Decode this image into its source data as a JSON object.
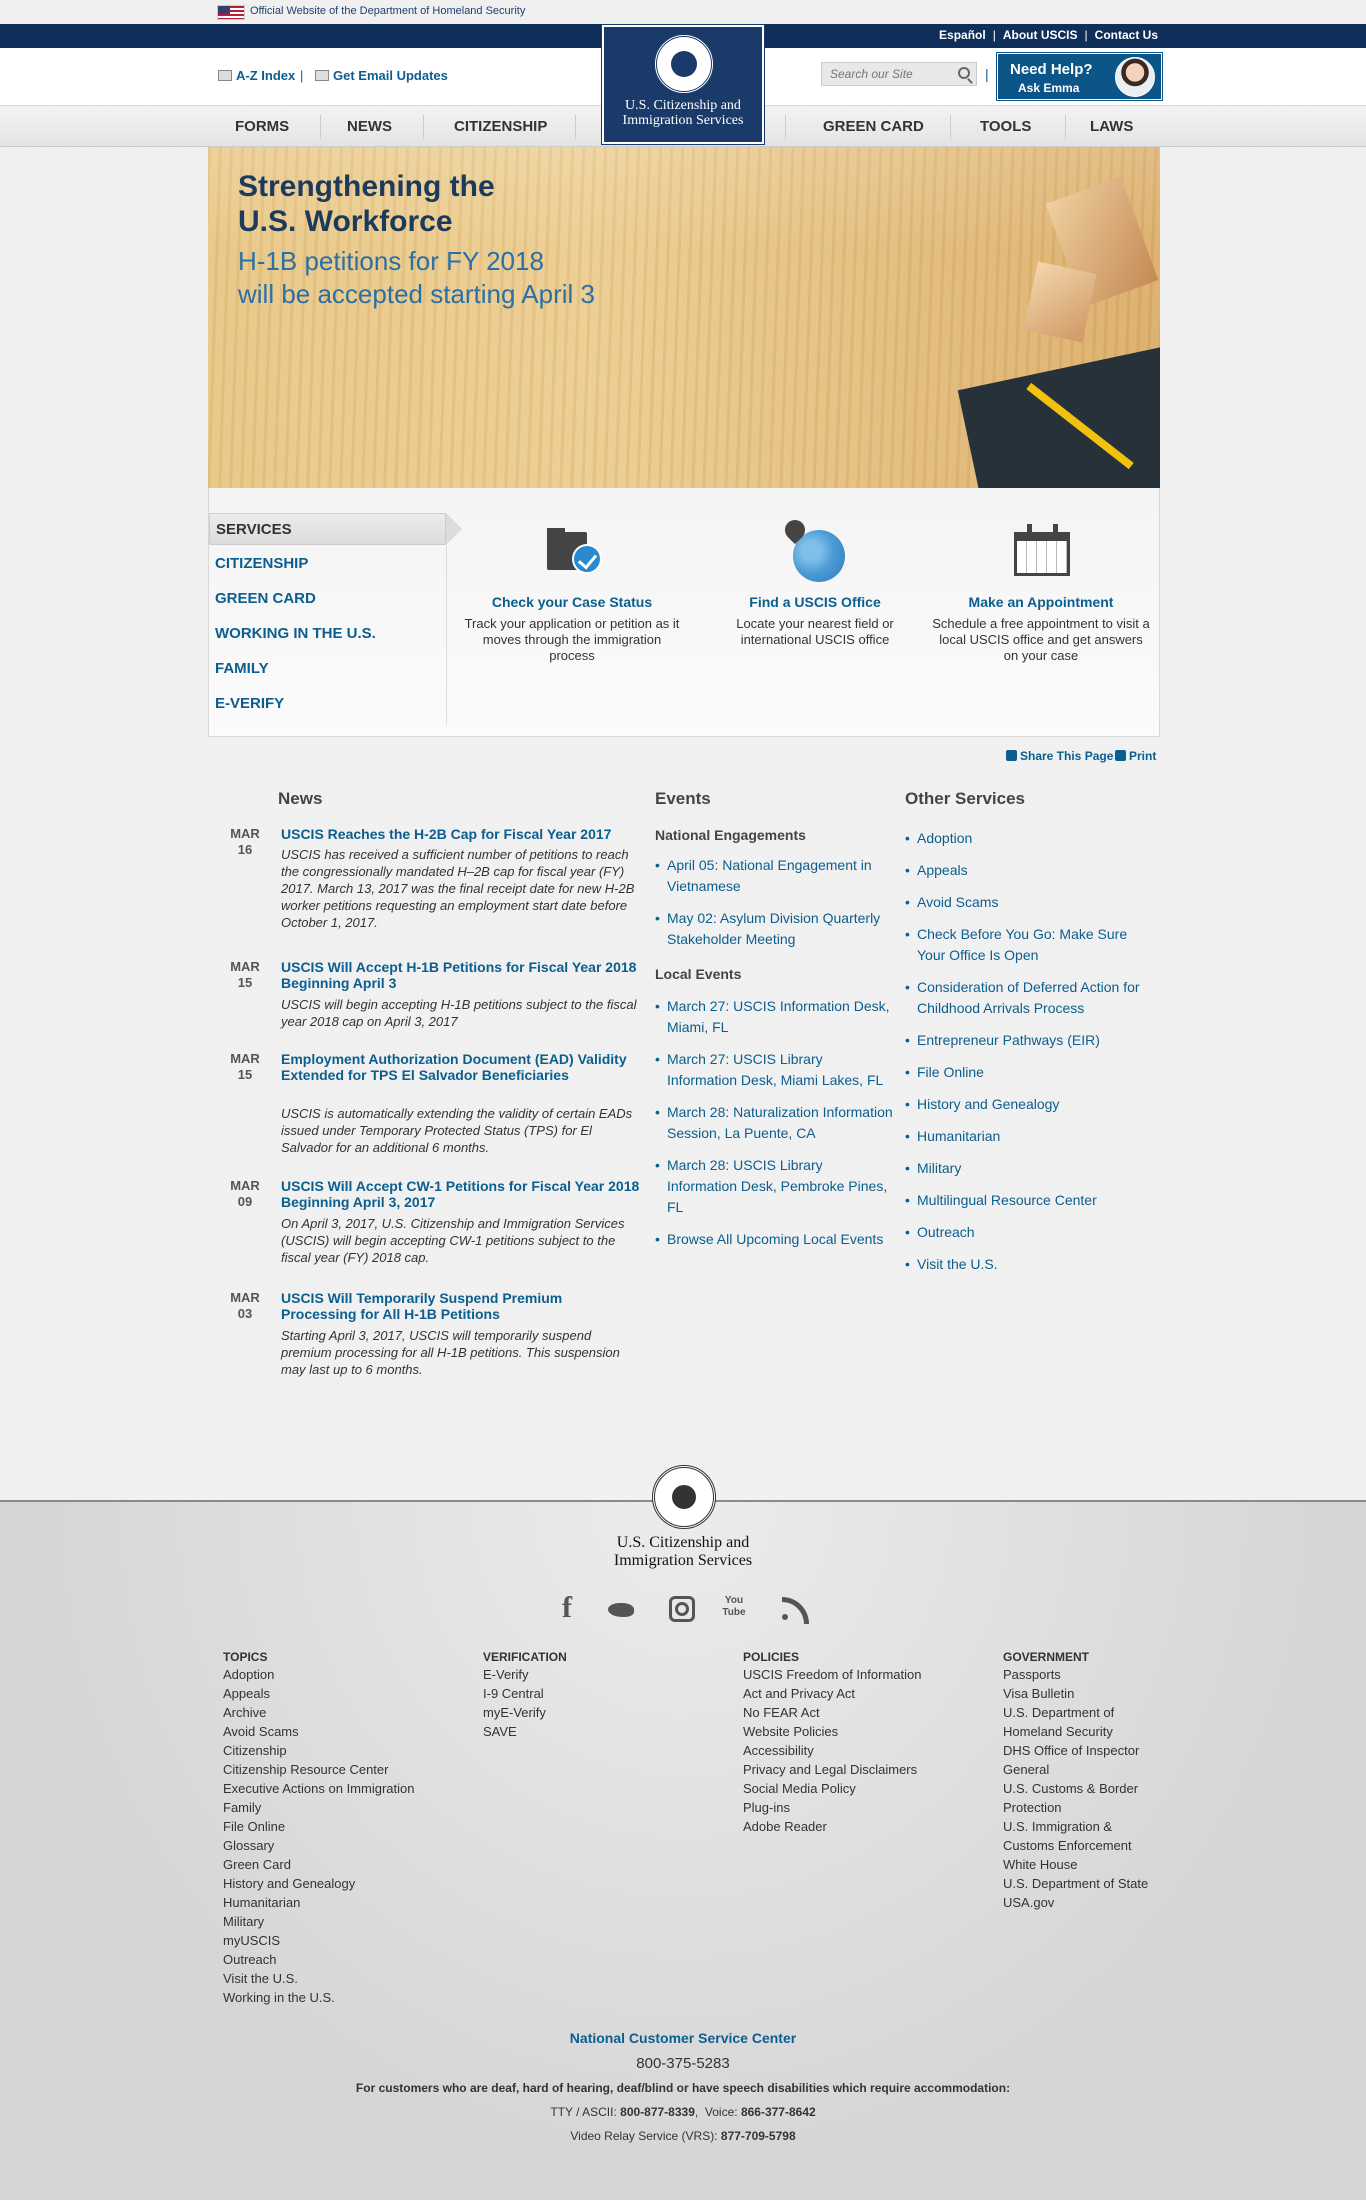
{
  "official_bar": {
    "text": "Official Website of the Department of Homeland Security"
  },
  "utility_links": [
    "Español",
    "About USCIS",
    "Contact Us"
  ],
  "header": {
    "az_index": "A-Z Index",
    "email_updates": "Get Email Updates",
    "search_placeholder": "Search our Site",
    "help_title": "Need Help?",
    "help_sub": "Ask Emma",
    "org_line1": "U.S. Citizenship and",
    "org_line2": "Immigration Services"
  },
  "nav": [
    "FORMS",
    "NEWS",
    "CITIZENSHIP",
    "GREEN CARD",
    "TOOLS",
    "LAWS"
  ],
  "hero": {
    "title_line1": "Strengthening the",
    "title_line2": "U.S. Workforce",
    "sub_line1": "H-1B petitions for FY 2018",
    "sub_line2": "will be accepted starting April 3"
  },
  "services": {
    "heading": "SERVICES",
    "items": [
      "CITIZENSHIP",
      "GREEN CARD",
      "WORKING IN THE U.S.",
      "FAMILY",
      "E-VERIFY"
    ],
    "tiles": [
      {
        "title": "Check your Case Status",
        "desc": "Track your application or petition as it moves through the immigration process",
        "icon": "folder-check-icon"
      },
      {
        "title": "Find a USCIS Office",
        "desc": "Locate your nearest field or international USCIS office",
        "icon": "globe-pin-icon"
      },
      {
        "title": "Make an Appointment",
        "desc": "Schedule a free appointment to visit a local USCIS office and get answers on your case",
        "icon": "calendar-icon"
      }
    ]
  },
  "share": {
    "share_label": "Share This Page",
    "print_label": "Print"
  },
  "news": {
    "heading": "News",
    "items": [
      {
        "month": "MAR",
        "day": "16",
        "title": "USCIS Reaches the H-2B Cap for Fiscal Year 2017",
        "body": "USCIS has received a sufficient number of petitions to reach the congressionally mandated H–2B cap for fiscal year (FY) 2017. March 13, 2017 was the final receipt date for new H-2B worker petitions requesting an employment start date before October 1, 2017."
      },
      {
        "month": "MAR",
        "day": "15",
        "title": "USCIS Will Accept H-1B Petitions for Fiscal Year 2018 Beginning April 3",
        "body": "USCIS will begin accepting H-1B petitions subject to the fiscal year 2018 cap on April 3, 2017"
      },
      {
        "month": "MAR",
        "day": "15",
        "title": "Employment Authorization Document (EAD) Validity Extended for TPS El Salvador Beneficiaries",
        "body": "USCIS is automatically extending the validity of certain EADs issued under Temporary Protected Status (TPS) for El Salvador for an additional 6 months."
      },
      {
        "month": "MAR",
        "day": "09",
        "title": "USCIS Will Accept CW-1 Petitions for Fiscal Year 2018 Beginning April 3, 2017",
        "body": "On April 3, 2017, U.S. Citizenship and Immigration Services (USCIS) will begin accepting CW-1 petitions subject to the fiscal year (FY) 2018 cap."
      },
      {
        "month": "MAR",
        "day": "03",
        "title": "USCIS Will Temporarily Suspend Premium Processing for All H-1B Petitions",
        "body": "Starting April 3, 2017, USCIS will temporarily suspend premium processing for all H-1B petitions. This suspension may last up to 6 months."
      }
    ]
  },
  "events": {
    "heading": "Events",
    "national_heading": "National Engagements",
    "national": [
      "April 05: National Engagement in Vietnamese",
      "May 02: Asylum Division Quarterly Stakeholder Meeting"
    ],
    "local_heading": "Local Events",
    "local": [
      "March 27: USCIS Information Desk, Miami, FL",
      "March 27: USCIS Library Information Desk, Miami Lakes, FL",
      "March 28: Naturalization Information Session, La Puente, CA",
      "March 28: USCIS Library Information Desk, Pembroke Pines, FL",
      "Browse All Upcoming Local Events"
    ]
  },
  "other_services": {
    "heading": "Other Services",
    "items": [
      "Adoption",
      "Appeals",
      "Avoid Scams",
      "Check Before You Go: Make Sure Your Office Is Open",
      "Consideration of Deferred Action for Childhood Arrivals Process",
      "Entrepreneur Pathways (EIR)",
      "File Online",
      "History and Genealogy",
      "Humanitarian",
      "Military",
      "Multilingual Resource Center",
      "Outreach",
      "Visit the U.S."
    ]
  },
  "footer": {
    "org_line1": "U.S. Citizenship and",
    "org_line2": "Immigration Services",
    "columns": [
      {
        "heading": "TOPICS",
        "links": [
          "Adoption",
          "Appeals",
          "Archive",
          "Avoid Scams",
          "Citizenship",
          "Citizenship Resource Center",
          "Executive Actions on Immigration",
          "Family",
          "File Online",
          "Glossary",
          "Green Card",
          "History and Genealogy",
          "Humanitarian",
          "Military",
          "myUSCIS",
          "Outreach",
          "Visit the U.S.",
          "Working in the U.S."
        ]
      },
      {
        "heading": "VERIFICATION",
        "links": [
          "E-Verify",
          "I-9 Central",
          "myE-Verify",
          "SAVE"
        ]
      },
      {
        "heading": "POLICIES",
        "links": [
          "USCIS Freedom of Information Act and Privacy Act",
          "No FEAR Act",
          "Website Policies",
          "Accessibility",
          "Privacy and Legal Disclaimers",
          "Social Media Policy",
          "Plug-ins",
          "Adobe Reader"
        ]
      },
      {
        "heading": "GOVERNMENT",
        "links": [
          "Passports",
          "Visa Bulletin",
          "U.S. Department of Homeland Security",
          "DHS Office of Inspector General",
          "U.S. Customs & Border Protection",
          "U.S. Immigration & Customs Enforcement",
          "White House",
          "U.S. Department of State",
          "USA.gov"
        ]
      }
    ],
    "ncsc_title": "National Customer Service Center",
    "phone": "800-375-5283",
    "accommodation": "For customers who are deaf, hard of hearing, deaf/blind or have speech disabilities which require accommodation:",
    "tty_label": "TTY / ASCII:",
    "tty_number": "800-877-8339",
    "voice_label": "Voice:",
    "voice_number": "866-377-8642",
    "vrs_label": "Video Relay Service (VRS):",
    "vrs_number": "877-709-5798"
  }
}
